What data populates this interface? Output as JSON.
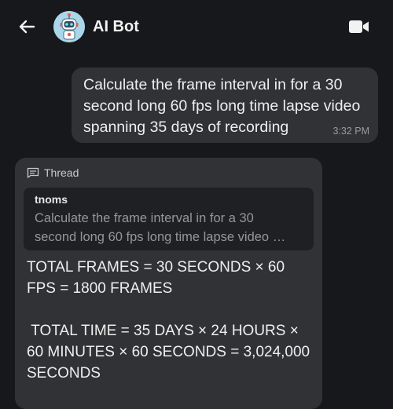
{
  "header": {
    "bot_name": "AI Bot",
    "back_icon": "arrow-left-icon",
    "avatar_icon": "robot-avatar",
    "video_icon": "video-camera-icon"
  },
  "messages": {
    "user": {
      "text": "Calculate the frame interval in for a 30 second long 60 fps long time lapse video spanning 35 days of recording",
      "time": "3:32 PM"
    },
    "bot": {
      "thread_label": "Thread",
      "thread_icon": "thread-icon",
      "quote_author": "tnoms",
      "quote_line_1": "Calculate the frame interval in for a 30",
      "quote_line_2": "second long 60 fps long time lapse video …",
      "answer_line_1": "TOTAL FRAMES = 30 SECONDS × 60 FPS = 1800 FRAMES",
      "answer_line_2": " TOTAL TIME = 35 DAYS × 24 HOURS × 60 MINUTES × 60 SECONDS = 3,024,000 SECONDS"
    }
  },
  "colors": {
    "background": "#17181b",
    "bubble": "#303236",
    "quote_background": "#1f2023",
    "avatar_background": "#a9d7e9"
  }
}
